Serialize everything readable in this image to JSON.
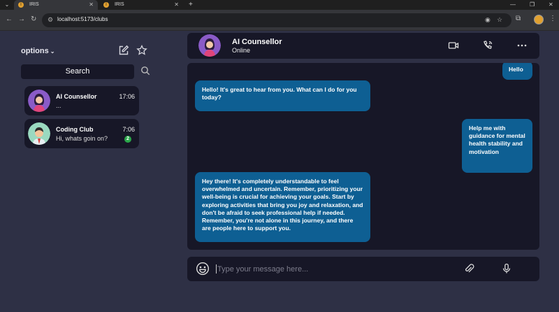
{
  "browser": {
    "tabs": [
      {
        "title": "IRIS",
        "active": true
      },
      {
        "title": "IRIS",
        "active": false
      }
    ],
    "url": "localhost:5173/clubs"
  },
  "sidebar": {
    "options_label": "options",
    "search_label": "Search",
    "chats": [
      {
        "name": "AI Counsellor",
        "preview": "...",
        "time": "17:06"
      },
      {
        "name": "Coding Club",
        "preview": "Hi, whats goin on?",
        "time": "7:06",
        "unread": "2"
      }
    ]
  },
  "header": {
    "name": "AI Counsellor",
    "status": "Online"
  },
  "messages": [
    {
      "from": "me",
      "text": "Hello"
    },
    {
      "from": "bot",
      "text": "Hello! It's great to hear from you. What can I do for you today?"
    },
    {
      "from": "me",
      "text": "Help me with guidance for mental health stability and motivation"
    },
    {
      "from": "bot",
      "text": "Hey there! It's completely understandable to feel overwhelmed and uncertain. Remember, prioritizing your well-being is crucial for achieving your goals. Start by exploring activities that bring you joy and relaxation, and don't be afraid to seek professional help if needed. Remember, you're not alone in this journey, and there are people here to support you."
    }
  ],
  "composer": {
    "placeholder": "Type your message here..."
  },
  "colors": {
    "background": "#2e3045",
    "panel": "#171727",
    "bubble": "#0e5f93",
    "unread_badge": "#2aa84a"
  }
}
